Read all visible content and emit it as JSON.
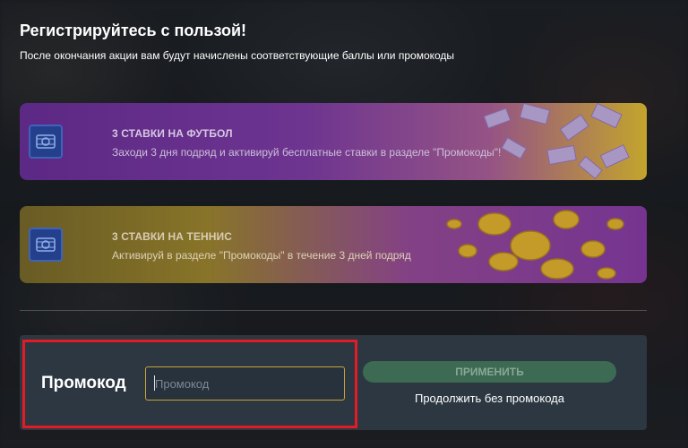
{
  "header": {
    "title": "Регистрируйтесь с пользой!",
    "subtitle": "После окончания акции вам будут начислены соответствующие баллы или промокоды"
  },
  "offers": [
    {
      "title": "3 СТАВКИ НА ФУТБОЛ",
      "description": "Заходи 3 дня подряд и активируй бесплатные ставки в разделе \"Промокоды\"!",
      "icon": "gift-card-icon"
    },
    {
      "title": "3 СТАВКИ НА ТЕННИС",
      "description": "Активируй в разделе \"Промокоды\" в течение 3 дней подряд",
      "icon": "gift-card-icon"
    }
  ],
  "promo": {
    "label": "Промокод",
    "input_placeholder": "Промокод",
    "input_value": "",
    "apply_label": "ПРИМЕНИТЬ",
    "skip_label": "Продолжить без промокода"
  },
  "colors": {
    "highlight": "#e31b23",
    "input_border": "#c9a438",
    "apply_button": "#3c6a52",
    "panel": "#2c3742"
  }
}
